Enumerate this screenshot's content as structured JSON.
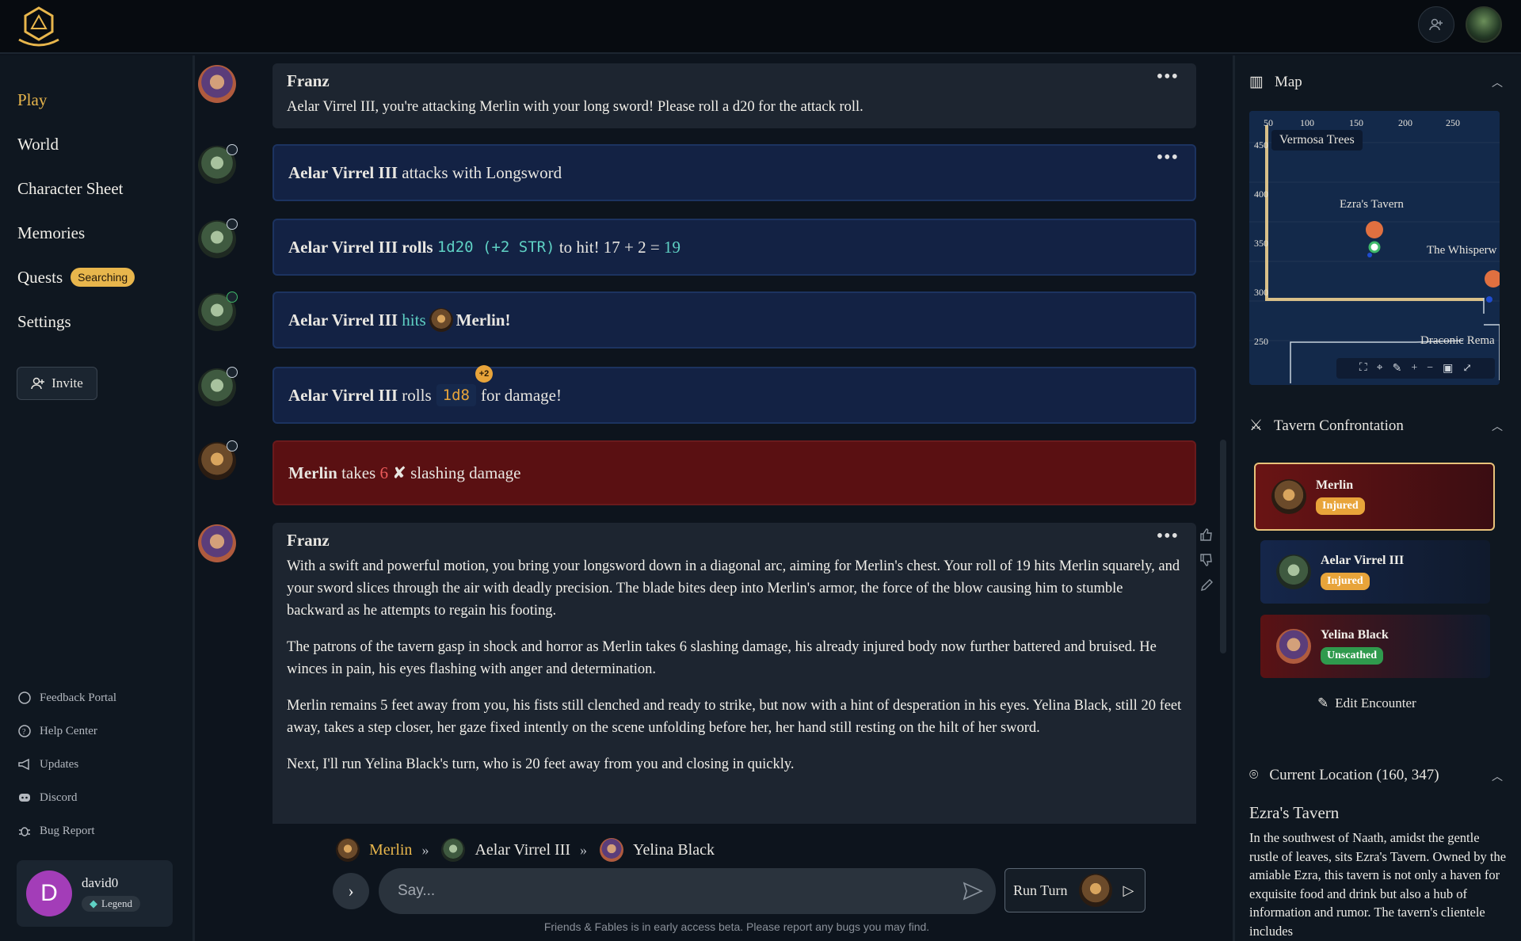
{
  "nav": {
    "items": [
      "Play",
      "World",
      "Character Sheet",
      "Memories",
      "Quests",
      "Settings"
    ],
    "quests_badge": "Searching",
    "invite": "Invite"
  },
  "footer_links": [
    "Feedback Portal",
    "Help Center",
    "Updates",
    "Discord",
    "Bug Report"
  ],
  "user": {
    "initial": "D",
    "name": "david0",
    "tier": "Legend"
  },
  "messages": {
    "m1": {
      "speaker": "Franz",
      "text": "Aelar Virrel III, you're attacking Merlin with your long sword! Please roll a d20 for the attack roll."
    },
    "m2": {
      "actor": "Aelar Virrel III",
      "text": "attacks with Longsword"
    },
    "m3": {
      "actor": "Aelar Virrel III",
      "verb": "rolls",
      "dice": "1d20 (+2 STR)",
      "mid": "to hit! 17 + 2 =",
      "total": "19"
    },
    "m4": {
      "actor": "Aelar Virrel III",
      "verb": "hits",
      "target": "Merlin!"
    },
    "m5": {
      "actor": "Aelar Virrel III",
      "verb": "rolls",
      "dice": "1d8",
      "bonus": "+2",
      "tail": "for damage!"
    },
    "m6": {
      "actor": "Merlin",
      "verb": "takes",
      "amount": "6",
      "tail1": "slashing",
      "tail2": "damage"
    },
    "m7": {
      "speaker": "Franz",
      "paragraphs": [
        "With a swift and powerful motion, you bring your longsword down in a diagonal arc, aiming for Merlin's chest. Your roll of 19 hits Merlin squarely, and your sword slices through the air with deadly precision. The blade bites deep into Merlin's armor, the force of the blow causing him to stumble backward as he attempts to regain his footing.",
        "The patrons of the tavern gasp in shock and horror as Merlin takes 6 slashing damage, his already injured body now further battered and bruised. He winces in pain, his eyes flashing with anger and determination.",
        "Merlin remains 5 feet away from you, his fists still clenched and ready to strike, but now with a hint of desperation in his eyes. Yelina Black, still 20 feet away, takes a step closer, her gaze fixed intently on the scene unfolding before her, her hand still resting on the hilt of her sword.",
        "Next, I'll run Yelina Black's turn, who is 20 feet away from you and closing in quickly."
      ]
    }
  },
  "turn_order": {
    "first": "Merlin",
    "second": "Aelar Virrel III",
    "third": "Yelina Black",
    "sep": "»"
  },
  "composer": {
    "placeholder": "Say...",
    "run_turn": "Run Turn"
  },
  "footer_note": "Friends & Fables is in early access beta. Please report any bugs you may find.",
  "map": {
    "title": "Map",
    "x_ticks": [
      "50",
      "100",
      "150",
      "200",
      "250"
    ],
    "y_ticks": [
      "450",
      "400",
      "350",
      "300",
      "250"
    ],
    "labels": {
      "region": "Vermosa Trees",
      "tavern": "Ezra's Tavern",
      "whisper": "The Whisperw",
      "draconic": "Draconic Rema"
    }
  },
  "encounter": {
    "title": "Tavern Confrontation",
    "combatants": [
      {
        "name": "Merlin",
        "status": "Injured"
      },
      {
        "name": "Aelar Virrel III",
        "status": "Injured"
      },
      {
        "name": "Yelina Black",
        "status": "Unscathed"
      }
    ],
    "edit": "Edit Encounter"
  },
  "location": {
    "header": "Current Location (160, 347)",
    "name": "Ezra's Tavern",
    "description": "In the southwest of Naath, amidst the gentle rustle of leaves, sits Ezra's Tavern. Owned by the amiable Ezra, this tavern is not only a haven for exquisite food and drink but also a hub of information and rumor. The tavern's clientele includes"
  },
  "colors": {
    "accent": "#e8b64c",
    "action_bg": "#132244",
    "damage_bg": "#5a1012",
    "hit": "#5fd1c4"
  }
}
